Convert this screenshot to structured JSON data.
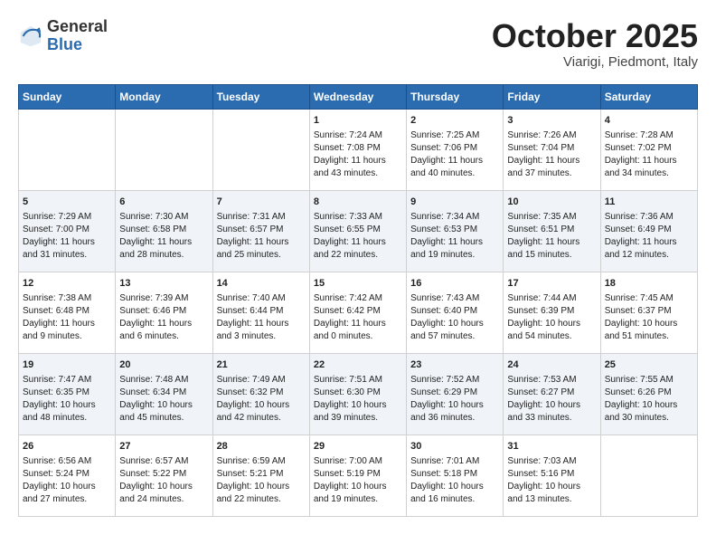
{
  "header": {
    "logo_general": "General",
    "logo_blue": "Blue",
    "month": "October 2025",
    "location": "Viarigi, Piedmont, Italy"
  },
  "days_of_week": [
    "Sunday",
    "Monday",
    "Tuesday",
    "Wednesday",
    "Thursday",
    "Friday",
    "Saturday"
  ],
  "weeks": [
    [
      {
        "day": "",
        "content": ""
      },
      {
        "day": "",
        "content": ""
      },
      {
        "day": "",
        "content": ""
      },
      {
        "day": "1",
        "content": "Sunrise: 7:24 AM\nSunset: 7:08 PM\nDaylight: 11 hours and 43 minutes."
      },
      {
        "day": "2",
        "content": "Sunrise: 7:25 AM\nSunset: 7:06 PM\nDaylight: 11 hours and 40 minutes."
      },
      {
        "day": "3",
        "content": "Sunrise: 7:26 AM\nSunset: 7:04 PM\nDaylight: 11 hours and 37 minutes."
      },
      {
        "day": "4",
        "content": "Sunrise: 7:28 AM\nSunset: 7:02 PM\nDaylight: 11 hours and 34 minutes."
      }
    ],
    [
      {
        "day": "5",
        "content": "Sunrise: 7:29 AM\nSunset: 7:00 PM\nDaylight: 11 hours and 31 minutes."
      },
      {
        "day": "6",
        "content": "Sunrise: 7:30 AM\nSunset: 6:58 PM\nDaylight: 11 hours and 28 minutes."
      },
      {
        "day": "7",
        "content": "Sunrise: 7:31 AM\nSunset: 6:57 PM\nDaylight: 11 hours and 25 minutes."
      },
      {
        "day": "8",
        "content": "Sunrise: 7:33 AM\nSunset: 6:55 PM\nDaylight: 11 hours and 22 minutes."
      },
      {
        "day": "9",
        "content": "Sunrise: 7:34 AM\nSunset: 6:53 PM\nDaylight: 11 hours and 19 minutes."
      },
      {
        "day": "10",
        "content": "Sunrise: 7:35 AM\nSunset: 6:51 PM\nDaylight: 11 hours and 15 minutes."
      },
      {
        "day": "11",
        "content": "Sunrise: 7:36 AM\nSunset: 6:49 PM\nDaylight: 11 hours and 12 minutes."
      }
    ],
    [
      {
        "day": "12",
        "content": "Sunrise: 7:38 AM\nSunset: 6:48 PM\nDaylight: 11 hours and 9 minutes."
      },
      {
        "day": "13",
        "content": "Sunrise: 7:39 AM\nSunset: 6:46 PM\nDaylight: 11 hours and 6 minutes."
      },
      {
        "day": "14",
        "content": "Sunrise: 7:40 AM\nSunset: 6:44 PM\nDaylight: 11 hours and 3 minutes."
      },
      {
        "day": "15",
        "content": "Sunrise: 7:42 AM\nSunset: 6:42 PM\nDaylight: 11 hours and 0 minutes."
      },
      {
        "day": "16",
        "content": "Sunrise: 7:43 AM\nSunset: 6:40 PM\nDaylight: 10 hours and 57 minutes."
      },
      {
        "day": "17",
        "content": "Sunrise: 7:44 AM\nSunset: 6:39 PM\nDaylight: 10 hours and 54 minutes."
      },
      {
        "day": "18",
        "content": "Sunrise: 7:45 AM\nSunset: 6:37 PM\nDaylight: 10 hours and 51 minutes."
      }
    ],
    [
      {
        "day": "19",
        "content": "Sunrise: 7:47 AM\nSunset: 6:35 PM\nDaylight: 10 hours and 48 minutes."
      },
      {
        "day": "20",
        "content": "Sunrise: 7:48 AM\nSunset: 6:34 PM\nDaylight: 10 hours and 45 minutes."
      },
      {
        "day": "21",
        "content": "Sunrise: 7:49 AM\nSunset: 6:32 PM\nDaylight: 10 hours and 42 minutes."
      },
      {
        "day": "22",
        "content": "Sunrise: 7:51 AM\nSunset: 6:30 PM\nDaylight: 10 hours and 39 minutes."
      },
      {
        "day": "23",
        "content": "Sunrise: 7:52 AM\nSunset: 6:29 PM\nDaylight: 10 hours and 36 minutes."
      },
      {
        "day": "24",
        "content": "Sunrise: 7:53 AM\nSunset: 6:27 PM\nDaylight: 10 hours and 33 minutes."
      },
      {
        "day": "25",
        "content": "Sunrise: 7:55 AM\nSunset: 6:26 PM\nDaylight: 10 hours and 30 minutes."
      }
    ],
    [
      {
        "day": "26",
        "content": "Sunrise: 6:56 AM\nSunset: 5:24 PM\nDaylight: 10 hours and 27 minutes."
      },
      {
        "day": "27",
        "content": "Sunrise: 6:57 AM\nSunset: 5:22 PM\nDaylight: 10 hours and 24 minutes."
      },
      {
        "day": "28",
        "content": "Sunrise: 6:59 AM\nSunset: 5:21 PM\nDaylight: 10 hours and 22 minutes."
      },
      {
        "day": "29",
        "content": "Sunrise: 7:00 AM\nSunset: 5:19 PM\nDaylight: 10 hours and 19 minutes."
      },
      {
        "day": "30",
        "content": "Sunrise: 7:01 AM\nSunset: 5:18 PM\nDaylight: 10 hours and 16 minutes."
      },
      {
        "day": "31",
        "content": "Sunrise: 7:03 AM\nSunset: 5:16 PM\nDaylight: 10 hours and 13 minutes."
      },
      {
        "day": "",
        "content": ""
      }
    ]
  ]
}
